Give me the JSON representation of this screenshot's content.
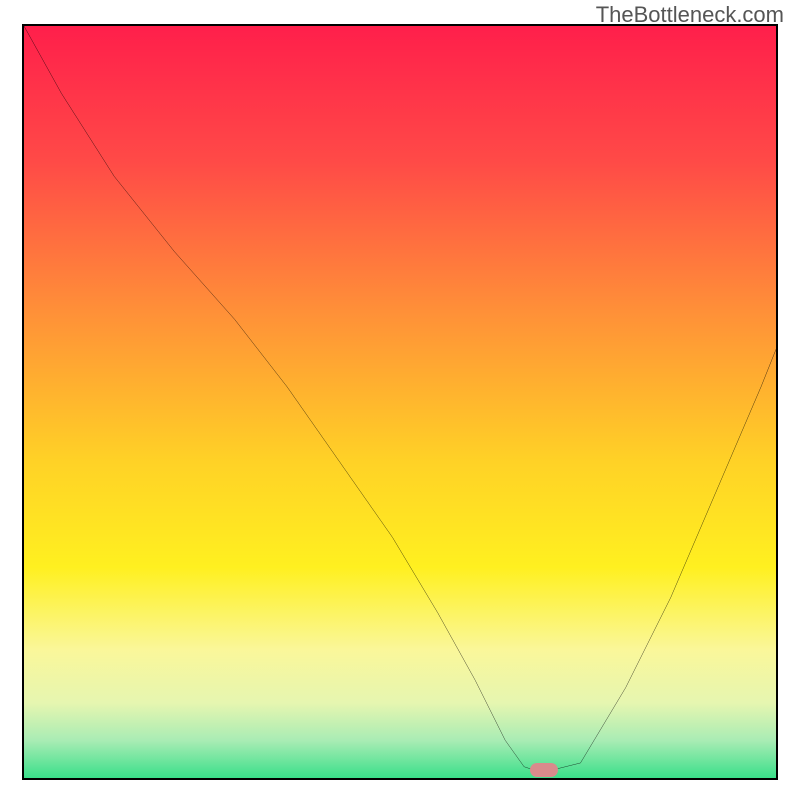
{
  "watermark": {
    "text": "TheBottleneck.com"
  },
  "chart_data": {
    "type": "line",
    "title": "",
    "xlabel": "",
    "ylabel": "",
    "xlim": [
      0,
      100
    ],
    "ylim": [
      0,
      100
    ],
    "gradient_stops": [
      {
        "offset": 0,
        "color": "#ff1f4b"
      },
      {
        "offset": 18,
        "color": "#ff4a47"
      },
      {
        "offset": 38,
        "color": "#ff9038"
      },
      {
        "offset": 58,
        "color": "#ffd226"
      },
      {
        "offset": 72,
        "color": "#fff020"
      },
      {
        "offset": 83,
        "color": "#faf79a"
      },
      {
        "offset": 90,
        "color": "#e6f6b0"
      },
      {
        "offset": 95,
        "color": "#a9ecb4"
      },
      {
        "offset": 100,
        "color": "#3adf8a"
      }
    ],
    "series": [
      {
        "name": "bottleneck-curve",
        "x": [
          0,
          5,
          12,
          20,
          28,
          35,
          42,
          49,
          55,
          60,
          64,
          66.5,
          68,
          70,
          74,
          80,
          86,
          92,
          98,
          100
        ],
        "y": [
          100,
          91,
          80,
          70,
          61,
          52,
          42,
          32,
          22,
          13,
          5,
          1.5,
          1,
          1,
          2,
          12,
          24,
          38,
          52,
          57
        ]
      }
    ],
    "marker": {
      "x": 69.2,
      "y": 1.1,
      "color": "#d98b8c"
    }
  }
}
